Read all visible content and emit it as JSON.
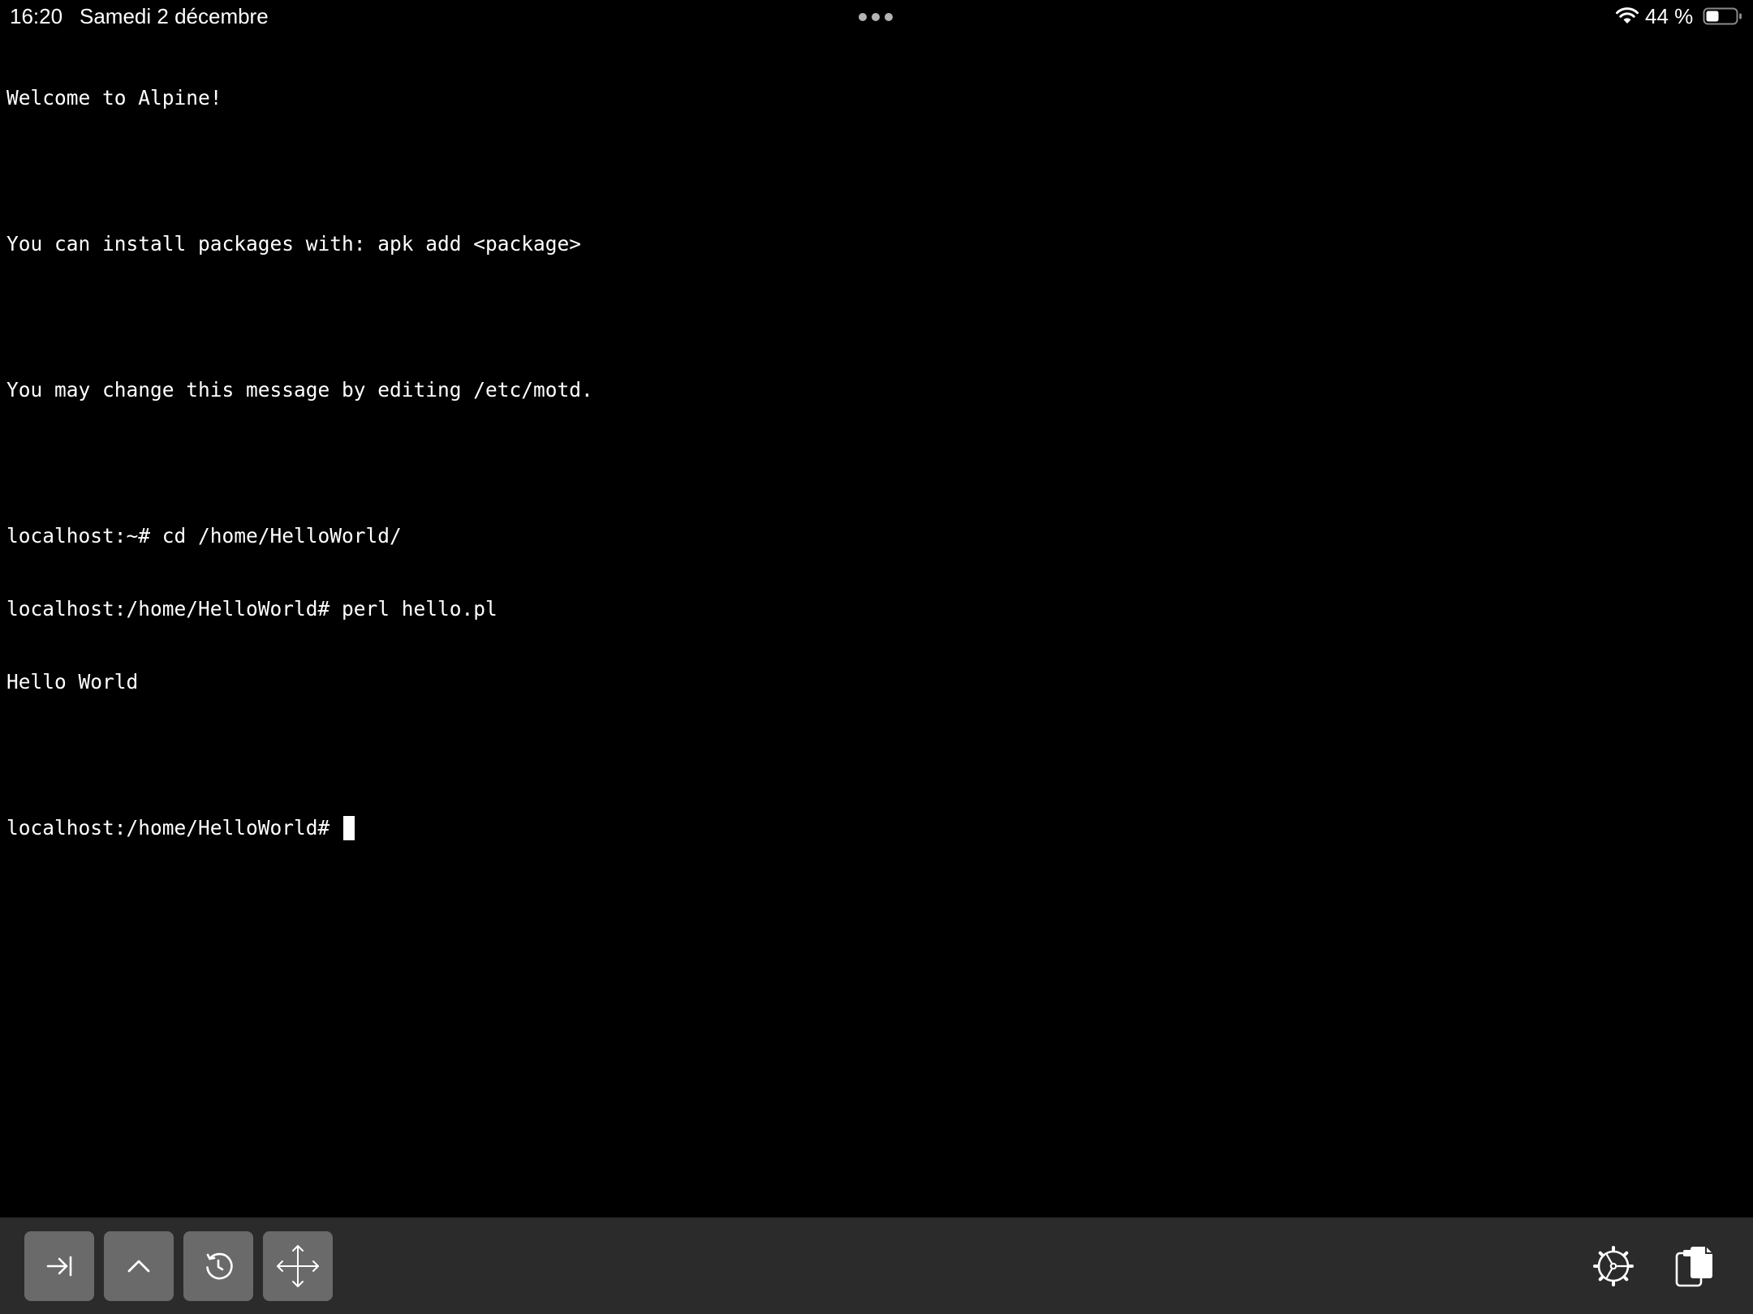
{
  "status_bar": {
    "time": "16:20",
    "date": "Samedi 2 décembre",
    "battery": "44 %"
  },
  "terminal": {
    "lines": [
      "Welcome to Alpine!",
      "",
      "You can install packages with: apk add <package>",
      "",
      "You may change this message by editing /etc/motd.",
      "",
      "localhost:~# cd /home/HelloWorld/",
      "localhost:/home/HelloWorld# perl hello.pl",
      "Hello World",
      ""
    ],
    "prompt": "localhost:/home/HelloWorld# "
  },
  "toolbar": {
    "left_buttons": [
      "tab-key-icon",
      "control-key-icon",
      "history-icon",
      "move-cursor-icon"
    ],
    "right_buttons": [
      "settings-icon",
      "paste-icon"
    ]
  },
  "colors": {
    "background": "#000000",
    "text": "#ffffff",
    "toolbar_bg": "#2b2b2b",
    "key_bg": "#6a6a6a"
  }
}
